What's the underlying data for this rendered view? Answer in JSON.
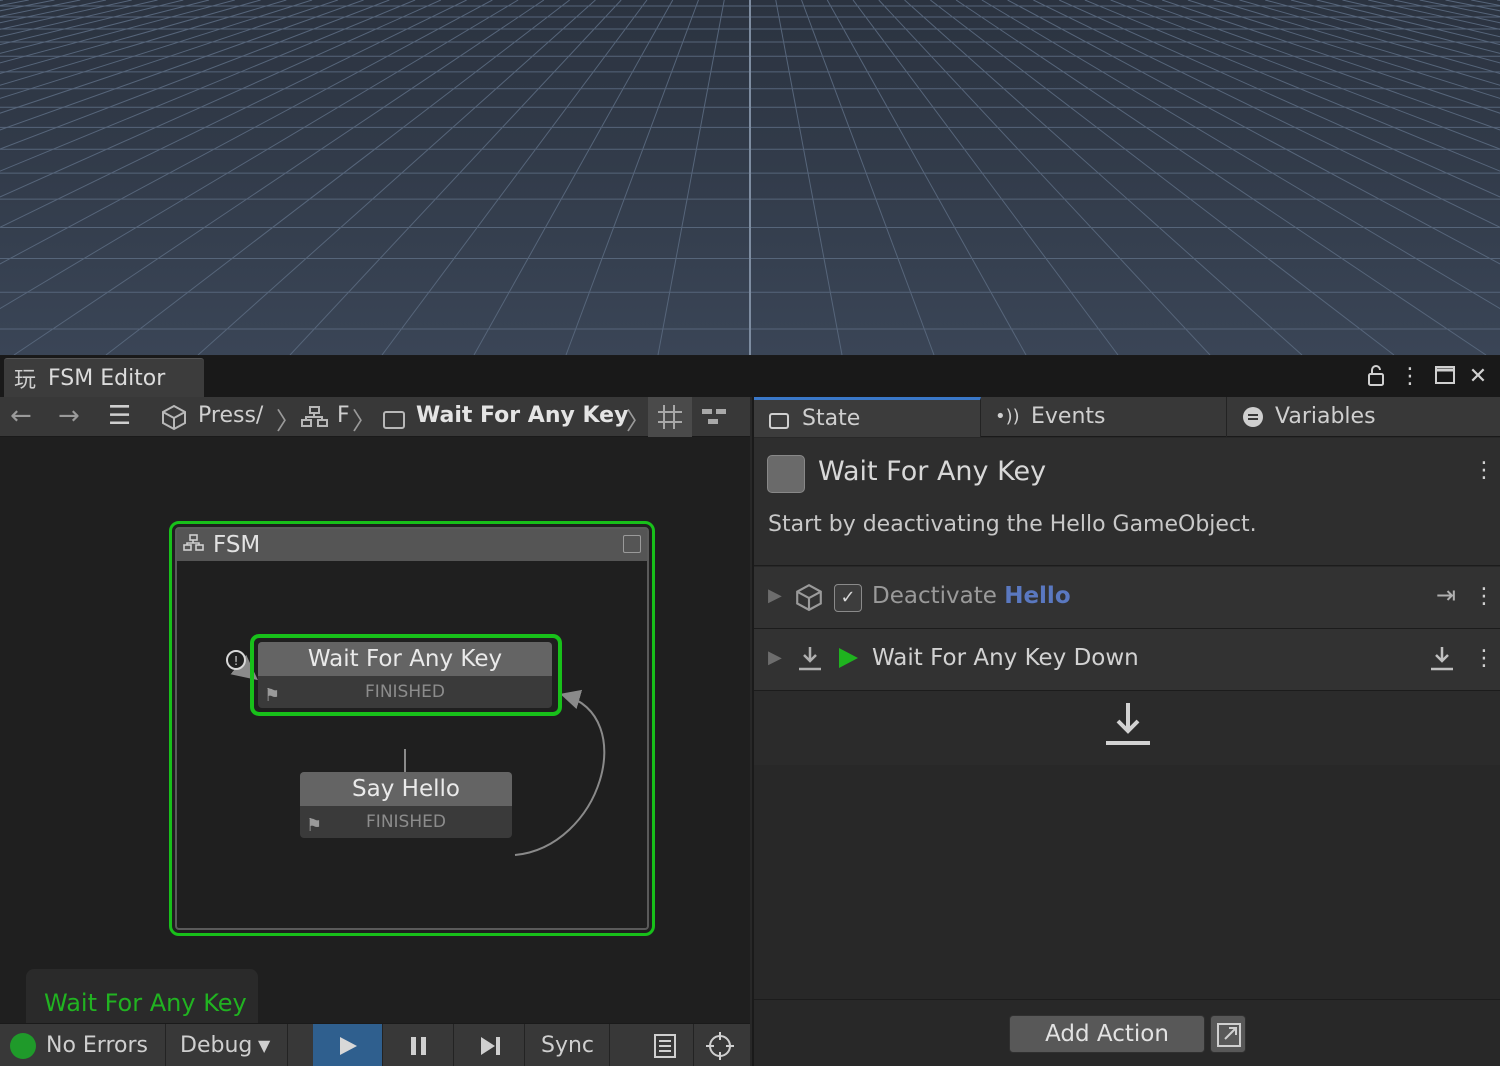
{
  "window": {
    "title": "FSM Editor"
  },
  "breadcrumb": {
    "object": "Press/",
    "fsm": "F",
    "state": "Wait For Any Key"
  },
  "graph": {
    "fsm_title": "FSM",
    "states": [
      {
        "name": "Wait For Any Key",
        "event": "FINISHED",
        "selected": true
      },
      {
        "name": "Say Hello",
        "event": "FINISHED",
        "selected": false
      }
    ],
    "active_state_label": "Wait For Any Key"
  },
  "statusbar": {
    "errors": "No Errors",
    "debug": "Debug",
    "sync": "Sync"
  },
  "inspector": {
    "tabs": [
      {
        "label": "State",
        "active": true
      },
      {
        "label": "Events",
        "active": false
      },
      {
        "label": "Variables",
        "active": false
      }
    ],
    "state_name": "Wait For Any Key",
    "state_description": "Start by deactivating the Hello GameObject.",
    "actions": [
      {
        "title_prefix": "Deactivate",
        "title_highlight": "Hello",
        "enabled": true
      },
      {
        "title_prefix": "Wait For Any Key Down",
        "title_highlight": "",
        "enabled": true
      }
    ],
    "add_action_label": "Add Action"
  },
  "colors": {
    "selection_green": "#18c01a",
    "active_label_green": "#21b321",
    "tab_accent": "#3a78c9",
    "play_button_blue": "#2f5f8e",
    "highlight_blue": "#5a78c0"
  }
}
